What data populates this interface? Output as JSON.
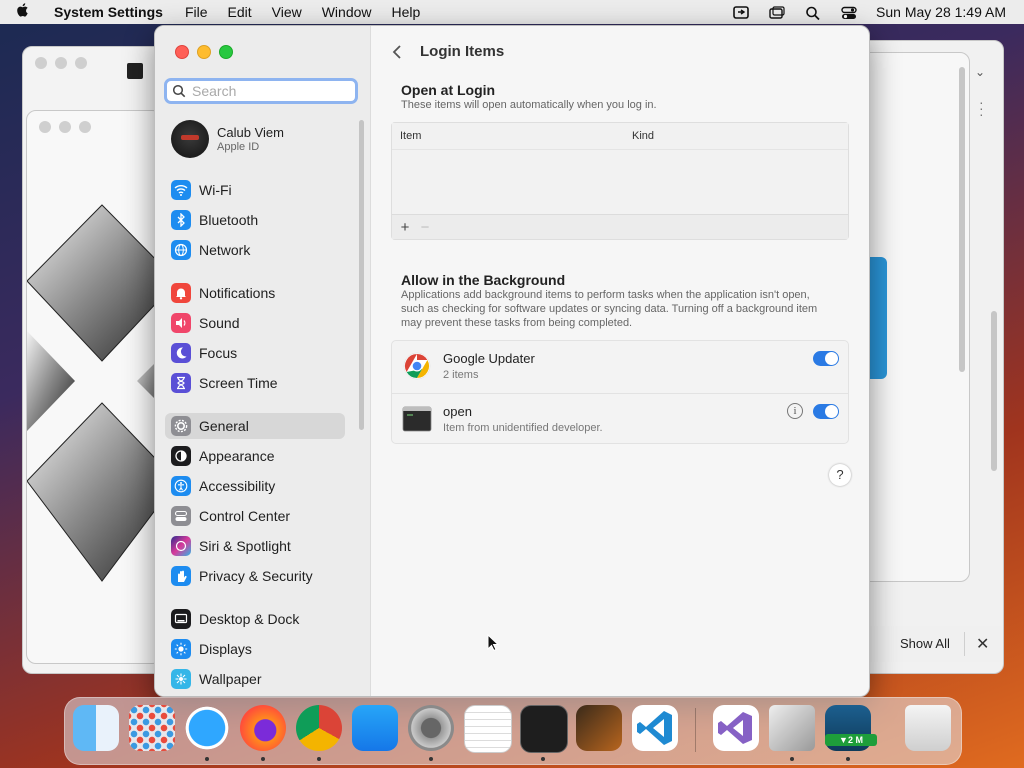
{
  "menubar": {
    "app_name": "System Settings",
    "menus": [
      "File",
      "Edit",
      "View",
      "Window",
      "Help"
    ],
    "datetime": "Sun May 28  1:49 AM"
  },
  "sidebar": {
    "search_placeholder": "Search",
    "profile": {
      "name": "Calub Viem",
      "subtitle": "Apple ID"
    },
    "items": [
      {
        "label": "Wi-Fi",
        "icon": "wifi-icon",
        "color": "#1d8cf0"
      },
      {
        "label": "Bluetooth",
        "icon": "bluetooth-icon",
        "color": "#1d8cf0"
      },
      {
        "label": "Network",
        "icon": "globe-icon",
        "color": "#1d8cf0"
      },
      {
        "label": "Notifications",
        "icon": "bell-icon",
        "color": "#f0463c"
      },
      {
        "label": "Sound",
        "icon": "speaker-icon",
        "color": "#f0466a"
      },
      {
        "label": "Focus",
        "icon": "moon-icon",
        "color": "#5a4fd6"
      },
      {
        "label": "Screen Time",
        "icon": "hourglass-icon",
        "color": "#5a4fd6"
      },
      {
        "label": "General",
        "icon": "gear-icon",
        "color": "#8e8e93",
        "selected": true
      },
      {
        "label": "Appearance",
        "icon": "appearance-icon",
        "color": "#1c1c1e"
      },
      {
        "label": "Accessibility",
        "icon": "accessibility-icon",
        "color": "#1d8cf0"
      },
      {
        "label": "Control Center",
        "icon": "control-center-icon",
        "color": "#8e8e93"
      },
      {
        "label": "Siri & Spotlight",
        "icon": "siri-icon",
        "color": "#b03ad8"
      },
      {
        "label": "Privacy & Security",
        "icon": "hand-icon",
        "color": "#1d8cf0"
      },
      {
        "label": "Desktop & Dock",
        "icon": "desktop-icon",
        "color": "#1c1c1e"
      },
      {
        "label": "Displays",
        "icon": "sun-icon",
        "color": "#1d8cf0"
      },
      {
        "label": "Wallpaper",
        "icon": "wallpaper-icon",
        "color": "#35b6e8"
      }
    ]
  },
  "content": {
    "title": "Login Items",
    "open_at_login": {
      "title": "Open at Login",
      "description": "These items will open automatically when you log in.",
      "columns": [
        "Item",
        "Kind"
      ],
      "add_label": "+",
      "remove_label": "−"
    },
    "background": {
      "title": "Allow in the Background",
      "description": "Applications add background items to perform tasks when the application isn't open, such as checking for software updates or syncing data. Turning off a background item may prevent these tasks from being completed.",
      "items": [
        {
          "name": "Google Updater",
          "subtitle": "2 items",
          "enabled": true,
          "icon": "chrome-icon"
        },
        {
          "name": "open",
          "subtitle": "Item from unidentified developer.",
          "enabled": true,
          "icon": "terminal-icon",
          "info": "i"
        }
      ]
    },
    "help_label": "?"
  },
  "notification": {
    "show_all": "Show All",
    "close": "✕"
  },
  "dock": {
    "apps": [
      "Finder",
      "Launchpad",
      "Safari",
      "Firefox",
      "Chrome",
      "App Store",
      "System Settings",
      "TextEdit",
      "Terminal",
      "GarageBand",
      "Visual Studio Code",
      "Visual Studio",
      "Utility",
      "Screen Recorder",
      "Trash"
    ],
    "badge": "▼2 M"
  }
}
